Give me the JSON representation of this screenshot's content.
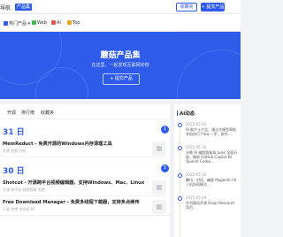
{
  "header": {
    "logo_text": "导航",
    "badge": "产品集",
    "fav_label": "收藏夹",
    "submit_label": "+ 提交产品"
  },
  "tabs": [
    {
      "label": "热门产品",
      "icon": "grid-icon",
      "color": "#2f5bea"
    },
    {
      "label": "Web",
      "icon": "web-icon",
      "color": "#3fb950"
    },
    {
      "label": "AI",
      "icon": "ai-icon",
      "color": "#e5534b"
    },
    {
      "label": "Top",
      "icon": "top-icon",
      "color": "#f0a020"
    }
  ],
  "search": {
    "placeholder": "搜索产品"
  },
  "hero": {
    "title": "蘑菇产品集",
    "subtitle": "在这里，一起发现互联网好物",
    "button": "+ 提交产品"
  },
  "subtabs": [
    "开源",
    "排行榜",
    "收藏夹"
  ],
  "feed": {
    "groups": [
      {
        "day": "31 日",
        "count": "1",
        "items": [
          {
            "title": "MemReduct - 免费开源的Windows内存清理工具",
            "tags": "开源  免费  内存"
          }
        ]
      },
      {
        "day": "30 日",
        "count": "5",
        "items": [
          {
            "title": "Shotcut - 开源跨平台视频编辑器，支持Windows、Mac、Linux",
            "tags": "开源  跨平台  视频剪辑  免费"
          },
          {
            "title": "Free Download Manager - 免费多线程下载器，支持多点续传",
            "tags": "下载  免费  多线程  BT"
          }
        ]
      }
    ]
  },
  "sidebar": {
    "title": "AI动态",
    "items": [
      {
        "time": "2025-05-31",
        "text": "AI 助产士产品，通过大模型帮助孕妈进行 Flow 一步，协作…"
      },
      {
        "time": "2025-05-30",
        "text": "谷歌 AI 编程智能体 Jules 全面开放，微软 GitHub Copilot 和 OpenAI Codex…"
      },
      {
        "time": "2025-05-30",
        "text": "腾讯：对话、编程 Magentic-UI 人机协同模式…"
      },
      {
        "time": "2025-05-29",
        "text": "字节跳动开源 Deep Research 项目…"
      }
    ]
  }
}
